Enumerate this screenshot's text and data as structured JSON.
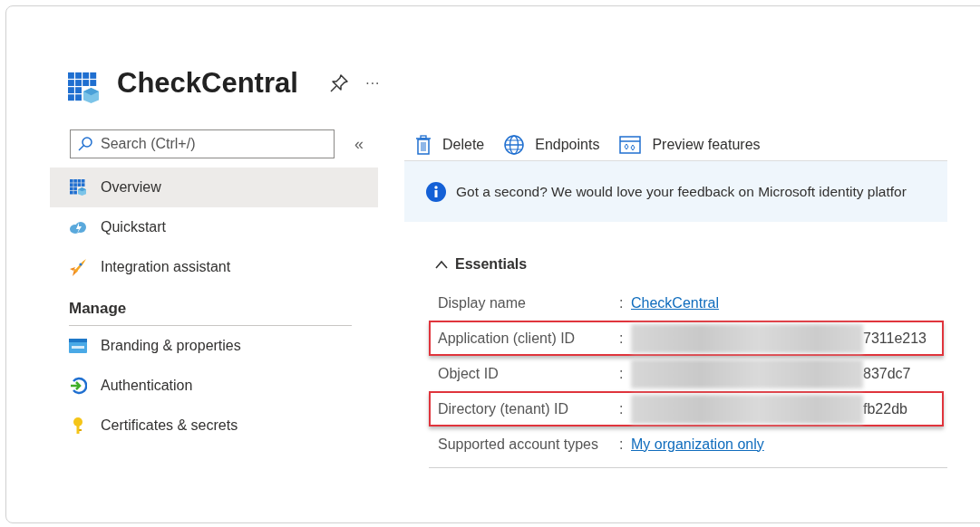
{
  "header": {
    "title": "CheckCentral",
    "more": "···"
  },
  "sidebar": {
    "search": {
      "placeholder": "Search (Ctrl+/)"
    },
    "collapse": "«",
    "items": [
      {
        "label": "Overview",
        "selected": true
      },
      {
        "label": "Quickstart",
        "selected": false
      },
      {
        "label": "Integration assistant",
        "selected": false
      }
    ],
    "section": "Manage",
    "manage_items": [
      {
        "label": "Branding & properties",
        "selected": false
      },
      {
        "label": "Authentication",
        "selected": false
      },
      {
        "label": "Certificates & secrets",
        "selected": false
      }
    ]
  },
  "toolbar": [
    {
      "label": "Delete"
    },
    {
      "label": "Endpoints"
    },
    {
      "label": "Preview features"
    }
  ],
  "banner": {
    "text": "Got a second? We would love your feedback on Microsoft identity platfor"
  },
  "essentials": {
    "title": "Essentials",
    "expanded": true,
    "rows": [
      {
        "label": "Display name",
        "separator": ":",
        "kind": "link",
        "value": "CheckCentral",
        "highlighted": false
      },
      {
        "label": "Application (client) ID",
        "separator": ":",
        "kind": "masked",
        "value": "7311e213",
        "highlighted": true
      },
      {
        "label": "Object ID",
        "separator": ":",
        "kind": "masked",
        "value": "837dc7",
        "highlighted": false
      },
      {
        "label": "Directory (tenant) ID",
        "separator": ":",
        "kind": "masked",
        "value": "fb22db",
        "highlighted": true
      },
      {
        "label": "Supported account types",
        "separator": ":",
        "kind": "link",
        "value": "My organization only",
        "highlighted": false
      }
    ]
  }
}
